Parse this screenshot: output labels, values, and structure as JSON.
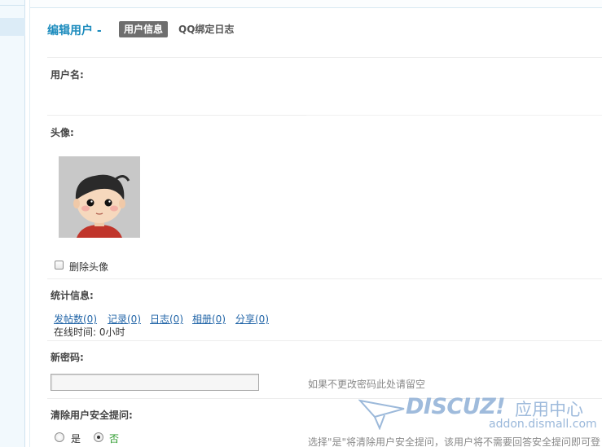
{
  "header": {
    "title": "编辑用户 -",
    "tab_active": "用户信息",
    "tab_log": "QQ绑定日志"
  },
  "fields": {
    "username_label": "用户名:",
    "avatar_label": "头像:",
    "delete_avatar_label": "删除头像",
    "stats_label": "统计信息:",
    "stats_links": [
      "发帖数(0)",
      "记录(0)",
      "日志(0)",
      "相册(0)",
      "分享(0)"
    ],
    "online_time": "在线时间: 0小时",
    "new_password_label": "新密码:",
    "new_password_value": "",
    "new_password_hint": "如果不更改密码此处请留空",
    "clear_security_label": "清除用户安全提问:",
    "radio_yes": "是",
    "radio_no": "否",
    "radio_selected": "否",
    "clear_security_hint": "选择\"是\"将清除用户安全提问，该用户将不需要回答安全提问即可登"
  },
  "watermark": {
    "logo": "DISCUZ!",
    "center": "应用中心",
    "url": "addon.dismall.com"
  },
  "colors": {
    "title": "#1b8bbd",
    "link": "#2366a8",
    "tab_active_bg": "#6e6e6e",
    "radio_no_text": "#2a9a2a"
  }
}
